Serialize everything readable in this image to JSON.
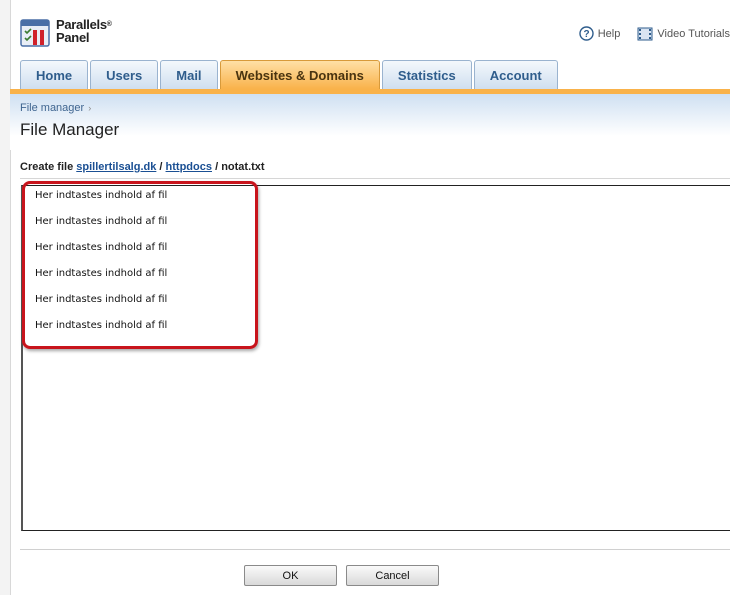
{
  "app": {
    "logo_line1": "Parallels",
    "logo_line2": "Panel",
    "logo_mark": "®"
  },
  "toplinks": {
    "help": "Help",
    "video": "Video Tutorials"
  },
  "tabs": [
    {
      "label": "Home"
    },
    {
      "label": "Users"
    },
    {
      "label": "Mail"
    },
    {
      "label": "Websites & Domains"
    },
    {
      "label": "Statistics"
    },
    {
      "label": "Account"
    }
  ],
  "active_tab": "Websites & Domains",
  "breadcrumb": {
    "item": "File manager",
    "sep": "›"
  },
  "page_title": "File Manager",
  "create": {
    "label": "Create file",
    "domain": "spillertilsalg.dk",
    "sep1": "/",
    "folder": "httpdocs",
    "sep2": "/",
    "filename": "notat.txt"
  },
  "editor": {
    "lines": [
      "Her indtastes indhold af fil",
      "Her indtastes indhold af fil",
      "Her indtastes indhold af fil",
      "Her indtastes indhold af fil",
      "Her indtastes indhold af fil",
      "Her indtastes indhold af fil"
    ]
  },
  "buttons": {
    "ok": "OK",
    "cancel": "Cancel"
  },
  "colors": {
    "active_tab": "#f9b24a",
    "highlight": "#c8141c",
    "link": "#1a4f93"
  }
}
